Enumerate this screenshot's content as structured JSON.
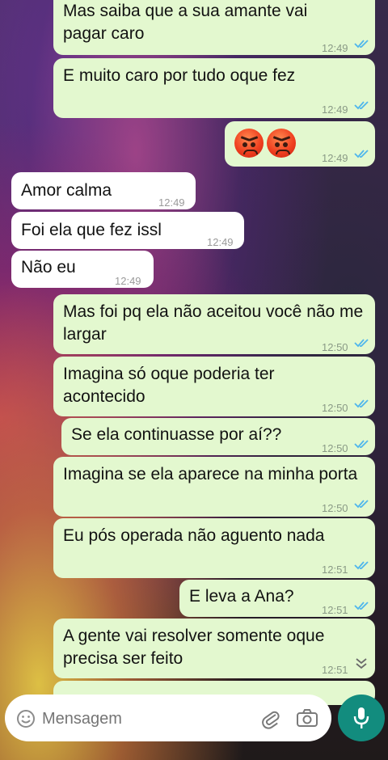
{
  "messages": [
    {
      "dir": "out",
      "text": "Mas saiba que a sua amante vai pagar caro",
      "time": "12:49"
    },
    {
      "dir": "out",
      "text": "E muito caro por tudo oque fez",
      "time": "12:49"
    },
    {
      "dir": "out",
      "emoji": "angry-face",
      "count": 2,
      "time": "12:49"
    },
    {
      "dir": "in",
      "text": "Amor calma",
      "time": "12:49"
    },
    {
      "dir": "in",
      "text": "Foi ela que fez issl",
      "time": "12:49"
    },
    {
      "dir": "in",
      "text": "Não eu",
      "time": "12:49"
    },
    {
      "dir": "out",
      "text": "Mas foi pq ela não aceitou você não me largar",
      "time": "12:50"
    },
    {
      "dir": "out",
      "text": "Imagina só oque poderia ter acontecido",
      "time": "12:50"
    },
    {
      "dir": "out",
      "text": "Se ela continuasse por aí??",
      "time": "12:50"
    },
    {
      "dir": "out",
      "text": "Imagina se ela aparece na minha porta",
      "time": "12:50"
    },
    {
      "dir": "out",
      "text": "Eu pós operada não aguento nada",
      "time": "12:51"
    },
    {
      "dir": "out",
      "text": "E leva a Ana?",
      "time": "12:51"
    },
    {
      "dir": "out",
      "text": "A gente vai resolver somente oque precisa ser feito",
      "time": "12:51"
    }
  ],
  "input": {
    "placeholder": "Mensagem"
  },
  "icons": {
    "read_ticks": "double-check-icon",
    "emoji": "smiley-icon",
    "attach": "paperclip-icon",
    "camera": "camera-icon",
    "mic": "microphone-icon",
    "scroll": "double-chevron-down-icon"
  },
  "colors": {
    "outgoing": "#e3f8cf",
    "incoming": "#ffffff",
    "tick": "#4fb6ec",
    "accent": "#128c7e"
  }
}
